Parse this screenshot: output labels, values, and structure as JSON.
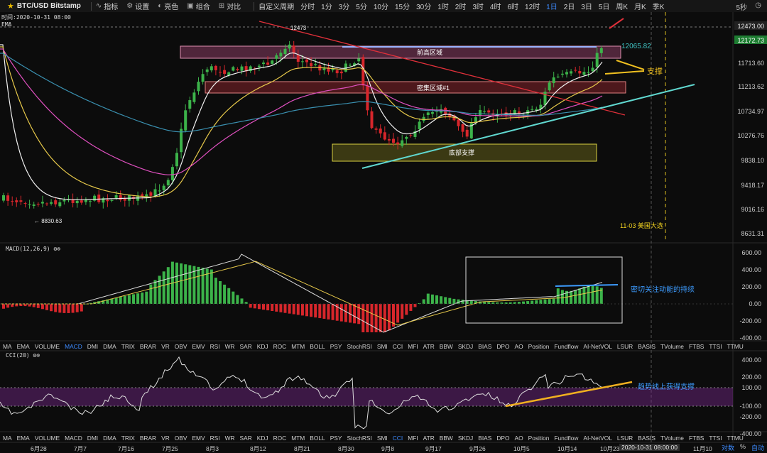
{
  "toolbar": {
    "symbol": "BTC/USD Bitstamp",
    "indicators_label": "指标",
    "settings_label": "设置",
    "theme_label": "亮色",
    "combo_label": "组合",
    "compare_label": "对比",
    "custom_period_label": "自定义周期",
    "periods": [
      "分时",
      "1分",
      "3分",
      "5分",
      "10分",
      "15分",
      "30分",
      "1时",
      "2时",
      "3时",
      "4时",
      "6时",
      "12时",
      "1日",
      "2日",
      "3日",
      "5日",
      "周K",
      "月K",
      "季K"
    ],
    "active_period": "1日",
    "refresh_label": "5秒"
  },
  "info": {
    "time_line": "时间:2020-10-31 08:00",
    "ema_label": "EMA"
  },
  "price_axis": {
    "labels": [
      "12473.00",
      "12172.73",
      "11713.60",
      "11213.62",
      "10734.97",
      "10276.76",
      "9838.10",
      "9418.17",
      "9016.16",
      "8631.31"
    ],
    "current_price": "12172.73",
    "high_price": "12473.00"
  },
  "annotations": {
    "high_label": "12473",
    "low_label": "← 8830.63",
    "zone_top": "前高区域",
    "zone_mid": "密集区域#1",
    "zone_bottom": "底部支撑",
    "support": "支撑",
    "price_note": "12065.82",
    "election": "11-03 美国大选",
    "macd_note": "密切关注动能的持续",
    "cci_note": "趋势线上获得支撑"
  },
  "macd": {
    "label": "MACD(12,26,9)",
    "axis": [
      "600.00",
      "400.00",
      "200.00",
      "0.00",
      "-200.00",
      "-400.00"
    ]
  },
  "cci": {
    "label": "CCI(20)",
    "axis": [
      "400.00",
      "200.00",
      "100.00",
      "-100.00",
      "-200.00",
      "-400.00"
    ]
  },
  "indicator_tabs": [
    "MA",
    "EMA",
    "VOLUME",
    "MACD",
    "DMI",
    "DMA",
    "TRIX",
    "BRAR",
    "VR",
    "OBV",
    "EMV",
    "RSI",
    "WR",
    "SAR",
    "KDJ",
    "ROC",
    "MTM",
    "BOLL",
    "PSY",
    "StochRSI",
    "SMI",
    "CCI",
    "MFI",
    "ATR",
    "BBW",
    "SKDJ",
    "BIAS",
    "DPO",
    "AO",
    "Position",
    "Fundflow",
    "AI-NetVOL",
    "LSUR",
    "BASIS",
    "TVolume",
    "FTBS",
    "TTSI",
    "TTMU"
  ],
  "indicator_tabs_active_1": "MACD",
  "indicator_tabs_active_2": "CCI",
  "x_axis": [
    "6月28",
    "7月7",
    "7月16",
    "7月25",
    "8月3",
    "8月12",
    "8月21",
    "8月30",
    "9月8",
    "9月17",
    "9月26",
    "10月5",
    "10月14",
    "10月23",
    "11月10"
  ],
  "current_time": "2020-10-31 08:00:00",
  "scale": {
    "log": "对数",
    "pct": "%",
    "auto": "自动"
  },
  "colors": {
    "up": "#3cb34a",
    "down": "#d8262b",
    "accent": "#3d8bff"
  }
}
